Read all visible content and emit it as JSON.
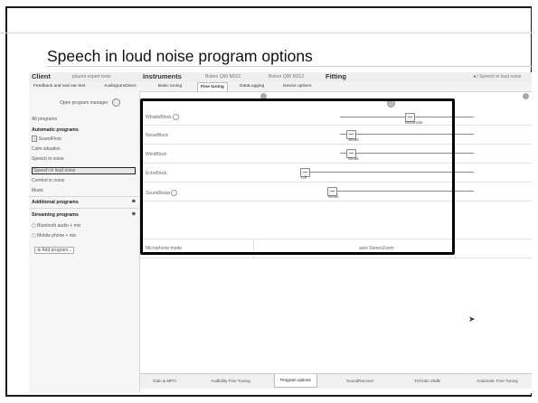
{
  "slide": {
    "title": "Speech in loud noise program options"
  },
  "app": {
    "client_label": "Client",
    "client_name": "pöunm expert tests",
    "instruments_label": "Instruments",
    "instrument_left": "Bolero Q90 M312",
    "instrument_right": "Bolero Q90 M312",
    "fitting_label": "Fitting",
    "current_program": "◄) Speech in loud noise"
  },
  "tabs": [
    {
      "label": "Feedback and real ear test",
      "active": false
    },
    {
      "label": "AudiogramDirect",
      "active": false
    },
    {
      "label": "Basic tuning",
      "active": false
    },
    {
      "label": "Fine tuning",
      "active": true
    },
    {
      "label": "DataLogging",
      "active": false
    },
    {
      "label": "Device options",
      "active": false
    }
  ],
  "sidebar": {
    "open_manager": "Open program manager",
    "all_programs": "All programs",
    "automatic_header": "Automatic programs",
    "soundflow": "SoundFlow",
    "calm": "Calm situation",
    "speech_noise": "Speech in noise",
    "speech_loud": "Speech in loud noise",
    "comfort": "Comfort in noise",
    "music": "Music",
    "additional_header": "Additional programs",
    "streaming_header": "Streaming programs",
    "bluetooth": "Bluetooth audio + mic",
    "mobile": "Mobile phone + mic",
    "add_program": "Add program..."
  },
  "params": [
    {
      "label": "WhistleBlock",
      "value": "Moderate"
    },
    {
      "label": "NoiseBlock",
      "value": "Weak"
    },
    {
      "label": "WindBlock",
      "value": "Weak"
    },
    {
      "label": "EchoBlock",
      "value": "Off"
    },
    {
      "label": "SoundRelax",
      "value": "Weak"
    }
  ],
  "microphone": {
    "label": "Microphone mode",
    "value": "auto StereoZoom"
  },
  "bottom_tabs": [
    {
      "label": "Gain & MPO",
      "active": false
    },
    {
      "label": "Audibility Fine Tuning",
      "active": false
    },
    {
      "label": "Program options",
      "active": true
    },
    {
      "label": "SoundRecover",
      "active": false
    },
    {
      "label": "TK/Gain 20dB",
      "active": false
    },
    {
      "label": "Automatic Fine Tuning",
      "active": false
    }
  ]
}
